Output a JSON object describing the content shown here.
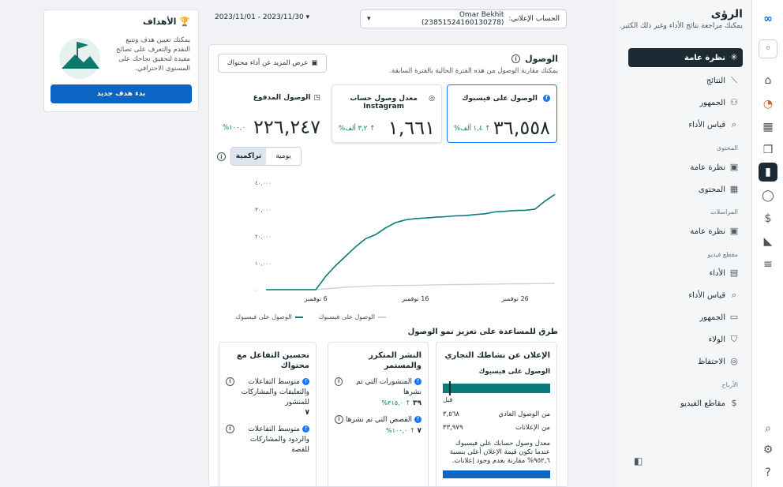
{
  "rail": {
    "icons": [
      "meta-icon",
      "account-avatar",
      "home-icon",
      "bell-icon",
      "table-icon",
      "pages-icon",
      "insights-icon",
      "chat-icon",
      "dollar-icon",
      "megaphone-icon",
      "menu-icon",
      "search-icon",
      "settings-icon",
      "help-icon"
    ]
  },
  "nav": {
    "title": "الرؤى",
    "subtitle": "يمكنك مراجعة نتائج الأداء وغير ذلك الكثير.",
    "items": [
      {
        "label": "نظرة عامة",
        "icon": "overview-icon"
      },
      {
        "label": "النتائج",
        "icon": "results-icon"
      },
      {
        "label": "الجمهور",
        "icon": "audience-icon"
      },
      {
        "label": "قياس الأداء",
        "icon": "benchmark-icon"
      }
    ],
    "sections": [
      {
        "title": "المحتوى",
        "items": [
          {
            "label": "نظرة عامة"
          },
          {
            "label": "المحتوى"
          }
        ]
      },
      {
        "title": "المراسلات",
        "items": [
          {
            "label": "نظرة عامة"
          }
        ]
      },
      {
        "title": "مقطع فيديو",
        "items": [
          {
            "label": "الأداء"
          },
          {
            "label": "قياس الأداء"
          },
          {
            "label": "الجمهور"
          },
          {
            "label": "الولاء"
          },
          {
            "label": "الاحتفاظ"
          }
        ]
      },
      {
        "title": "الأرباح",
        "items": [
          {
            "label": "مقاطع الفيديو"
          }
        ]
      }
    ]
  },
  "account": {
    "label": "الحساب الإعلاني:",
    "name": "Omar Bekhit (23851524160130278)"
  },
  "dates": {
    "range": "2023/11/01 - 2023/11/30"
  },
  "goals": {
    "title": "الأهداف",
    "desc": "يمكنك تعيين هدف وتتبع التقدم والتعرف على نصائح مفيدة لتحقيق نجاحك على المستوى الاحترافي.",
    "button": "بدء هدف جديد"
  },
  "reach": {
    "title": "الوصول",
    "desc": "يمكنك مقارنة الوصول من هذه الفترة الحالية بالفترة السابقة.",
    "more_button": "عرض المزيد عن أداء محتواك",
    "metrics": [
      {
        "label": "الوصول على فيسبوك",
        "value": "٣٦,٥٥٨",
        "change": "↑ ١,٤ ألف%"
      },
      {
        "label": "معدل وصول حساب Instagram",
        "value": "١,٦٦١",
        "change": "↑ ٣,٢ ألف%"
      },
      {
        "label": "الوصول المدفوع",
        "value": "٢٢٦,٢٤٧",
        "change": "١٠٠,٠%"
      }
    ],
    "toggle": {
      "daily": "يومية",
      "cumulative": "تراكمية"
    }
  },
  "chart_data": {
    "type": "line",
    "x": [
      "1",
      "2",
      "3",
      "4",
      "5",
      "6",
      "7",
      "8",
      "9",
      "10",
      "11",
      "12",
      "13",
      "14",
      "15",
      "16",
      "17",
      "18",
      "19",
      "20",
      "21",
      "22",
      "23",
      "24",
      "25",
      "26",
      "27",
      "28",
      "29",
      "30"
    ],
    "x_tick_labels": [
      "6 نوفمبر",
      "16 نوفمبر",
      "26 نوفمبر"
    ],
    "y_tick_labels": [
      "٠",
      "١٠,٠٠٠",
      "٢٠,٠٠٠",
      "٣٠,٠٠٠",
      "٤٠,٠٠٠"
    ],
    "ylim": [
      0,
      40000
    ],
    "series": [
      {
        "name": "الوصول على فيسبوك",
        "color": "#0a7a7a",
        "values": [
          0,
          0,
          0,
          0,
          0,
          0,
          5000,
          9000,
          12500,
          16000,
          19000,
          20500,
          23000,
          25000,
          26000,
          26500,
          26700,
          27000,
          27200,
          27500,
          27600,
          28000,
          28300,
          29000,
          29200,
          29500,
          29600,
          30000,
          33000,
          35500
        ]
      },
      {
        "name": "الوصول على فيسبوك",
        "color": "#cfd3d8",
        "values": [
          0,
          0,
          0,
          0,
          0,
          0,
          300,
          600,
          900,
          1100,
          1300,
          1400,
          1500,
          1550,
          1600,
          1650,
          1700,
          1800,
          1850,
          1900,
          1950,
          2000,
          2050,
          2100,
          2150,
          2200,
          2200,
          2250,
          2300,
          2350
        ]
      }
    ],
    "legend": "bottom"
  },
  "tips": {
    "title": "طرق للمساعدة على تعزيز نمو الوصول",
    "cards": [
      {
        "title": "الإعلان عن نشاطك التجاري",
        "sub": "الوصول على فيسبوك",
        "before_label": "قبل",
        "organic_label": "من الوصول العادي",
        "organic_value": "٣,٥٦٨",
        "ads_label": "من الإعلانات",
        "ads_value": "٣٣,٩٧٩",
        "note": "معدل وصول حسابك على فيسبوك عندما تكون قيمة الإعلان أعلى بنسبة ٩٥٢,٦% مقارنة بعدم وجود إعلانات."
      },
      {
        "title": "النشر المتكرر والمستمر",
        "posts_label": "المنشورات التي تم نشرها",
        "posts_value": "٣٩",
        "posts_change": "↑ ٣١٥,٠%",
        "stories_label": "القصص التي تم نشرها",
        "stories_value": "٧",
        "stories_change": "↑ ١٠٠,٠%"
      },
      {
        "title": "تحسين التفاعل مع محتواك",
        "avg_post_label": "متوسط التفاعلات والتعليقات والمشاركات للمنشور",
        "avg_post_value": "٧",
        "avg_story_label": "متوسط التفاعلات والردود والمشاركات للقصة"
      }
    ]
  }
}
